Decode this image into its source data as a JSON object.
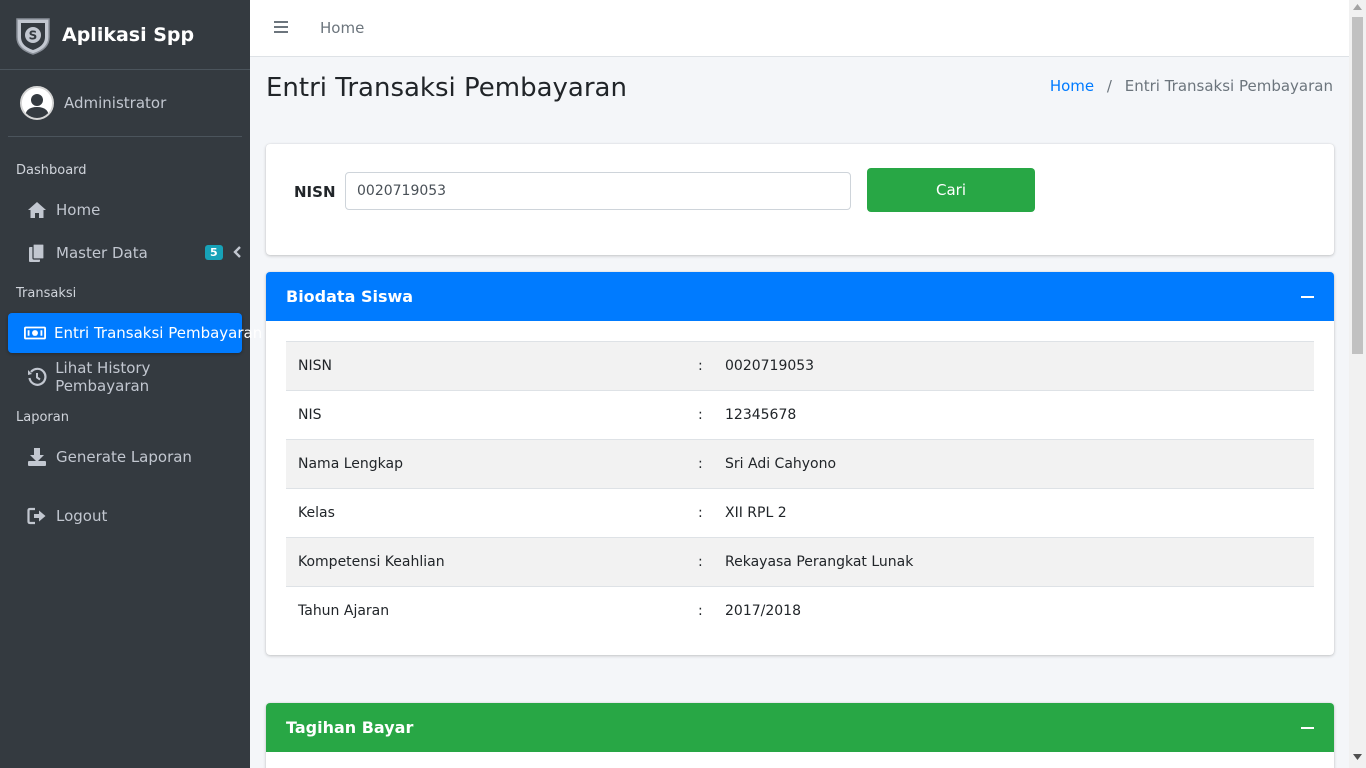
{
  "brand": {
    "title": "Aplikasi Spp",
    "logo_icon": "shield-dollar-icon"
  },
  "user": {
    "name": "Administrator"
  },
  "sidebar": {
    "headers": [
      "Dashboard",
      "Transaksi",
      "Laporan"
    ],
    "items": [
      {
        "label": "Home",
        "icon": "home-icon"
      },
      {
        "label": "Master Data",
        "icon": "copy-icon",
        "badge": "5"
      },
      {
        "label": "Entri Transaksi Pembayaran",
        "icon": "money-bill-icon",
        "active": true
      },
      {
        "label": "Lihat History Pembayaran",
        "icon": "history-icon"
      },
      {
        "label": "Generate Laporan",
        "icon": "download-icon"
      },
      {
        "label": "Logout",
        "icon": "sign-out-icon"
      }
    ]
  },
  "topbar": {
    "home_link": "Home"
  },
  "page": {
    "title": "Entri Transaksi Pembayaran",
    "breadcrumb": {
      "home": "Home",
      "separator": "/",
      "current": "Entri Transaksi Pembayaran"
    }
  },
  "search": {
    "label": "NISN",
    "value": "0020719053",
    "button": "Cari"
  },
  "biodata": {
    "title": "Biodata Siswa",
    "colon": ":",
    "rows": [
      {
        "label": "NISN",
        "value": "0020719053"
      },
      {
        "label": "NIS",
        "value": "12345678"
      },
      {
        "label": "Nama Lengkap",
        "value": "Sri Adi Cahyono"
      },
      {
        "label": "Kelas",
        "value": "XII RPL 2"
      },
      {
        "label": "Kompetensi Keahlian",
        "value": "Rekayasa Perangkat Lunak"
      },
      {
        "label": "Tahun Ajaran",
        "value": "2017/2018"
      }
    ]
  },
  "tagihan": {
    "title": "Tagihan Bayar"
  },
  "colors": {
    "sidebar": "#343a40",
    "primary": "#007bff",
    "success": "#28a745",
    "info": "#17a2b8"
  }
}
